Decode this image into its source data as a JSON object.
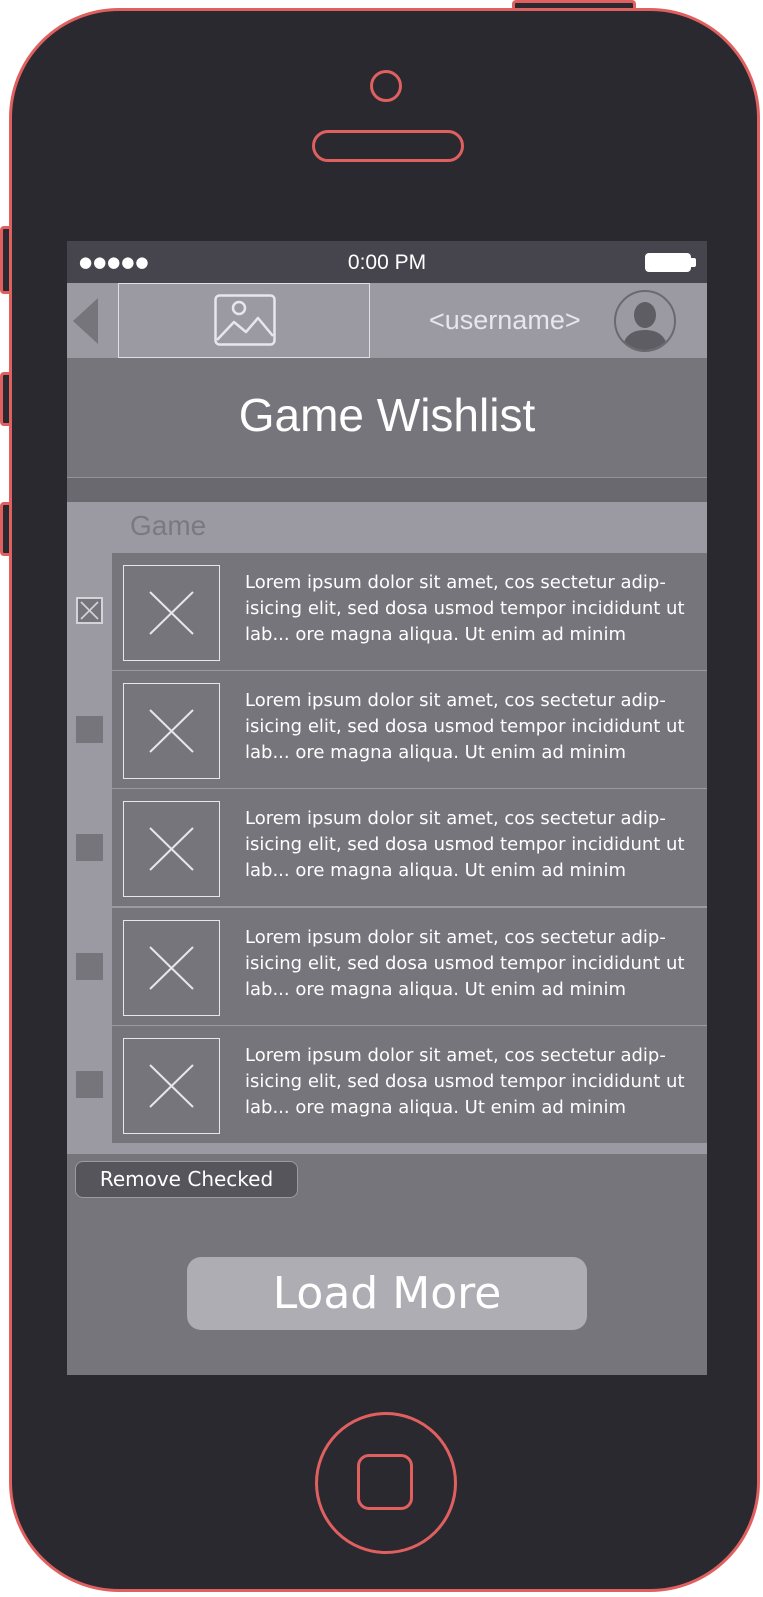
{
  "status_bar": {
    "signal": "●●●●●",
    "time": "0:00 PM"
  },
  "nav": {
    "username": "<username>"
  },
  "page": {
    "title": "Game Wishlist"
  },
  "list": {
    "column_header": "Game",
    "items": [
      {
        "checked": true,
        "description": "Lorem ipsum dolor sit amet, cos sectetur adip-isicing elit, sed dosa usmod tempor incididunt ut lab... ore magna aliqua. Ut enim ad minim"
      },
      {
        "checked": false,
        "description": "Lorem ipsum dolor sit amet, cos sectetur adip-isicing elit, sed dosa usmod tempor incididunt ut lab... ore magna aliqua. Ut enim ad minim"
      },
      {
        "checked": false,
        "description": "Lorem ipsum dolor sit amet, cos sectetur adip-isicing elit, sed dosa usmod tempor incididunt ut lab... ore magna aliqua. Ut enim ad minim"
      },
      {
        "checked": false,
        "description": "Lorem ipsum dolor sit amet, cos sectetur adip-isicing elit, sed dosa usmod tempor incididunt ut lab... ore magna aliqua. Ut enim ad minim"
      },
      {
        "checked": false,
        "description": "Lorem ipsum dolor sit amet, cos sectetur adip-isicing elit, sed dosa usmod tempor incididunt ut lab... ore magna aliqua. Ut enim ad minim"
      }
    ]
  },
  "actions": {
    "remove_label": "Remove Checked",
    "load_more_label": "Load More"
  },
  "colors": {
    "device_outline": "#e06060",
    "device_body": "#2a292f",
    "screen_bg": "#76757c",
    "panel_light": "#9b9aa3"
  }
}
